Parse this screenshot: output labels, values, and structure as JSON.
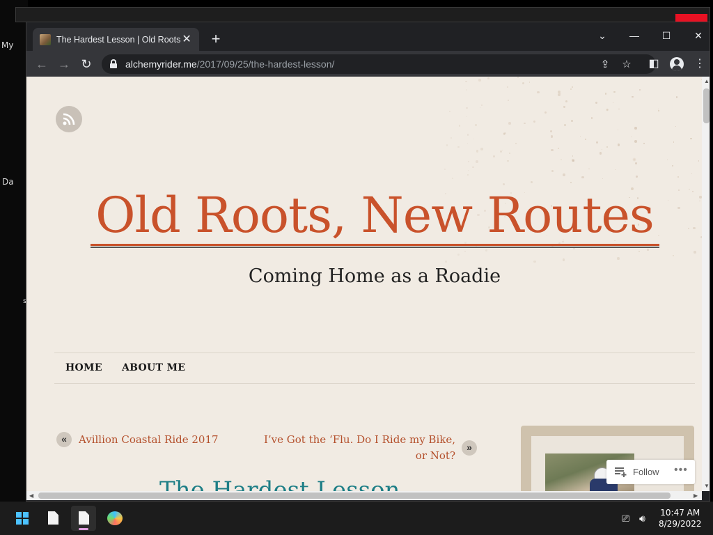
{
  "desktop": {
    "left_labels": [
      "My",
      "Da",
      "s"
    ]
  },
  "browser": {
    "tab": {
      "title": "The Hardest Lesson | Old Roots, N",
      "close_glyph": "✕"
    },
    "new_tab_glyph": "+",
    "window_controls": {
      "tab_search": "⌄",
      "minimize": "—",
      "maximize": "☐",
      "close": "✕"
    },
    "url": {
      "domain": "alchemyrider.me",
      "path": "/2017/09/25/the-hardest-lesson/"
    },
    "icons": {
      "back": "←",
      "forward": "→",
      "reload": "↻",
      "share": "⇪",
      "bookmark": "☆",
      "side_panel": "◧",
      "menu": "⋮"
    }
  },
  "site": {
    "title": "Old Roots, New Routes",
    "tagline": "Coming Home as a Roadie",
    "menu": [
      "HOME",
      "ABOUT ME"
    ],
    "prev_post": "Avillion Coastal Ride 2017",
    "next_post_line1": "I’ve Got the ‘Flu. Do I Ride my Bike,",
    "next_post_line2": "or Not?",
    "prev_arrow": "«",
    "next_arrow": "»",
    "post_title": "The Hardest Lesson",
    "follow_label": "Follow",
    "follow_more": "•••",
    "colors": {
      "title": "#c9522b",
      "link": "#b4502c",
      "post_title": "#1d7e86",
      "background": "#f1ebe3"
    }
  },
  "taskbar": {
    "time": "10:47 AM",
    "date": "8/29/2022"
  }
}
